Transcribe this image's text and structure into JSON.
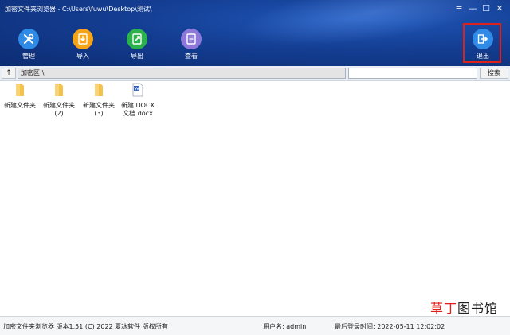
{
  "window": {
    "title": "加密文件夹浏览器 - C:\\Users\\fuwu\\Desktop\\测试\\",
    "controls": {
      "menu": "≡",
      "minimize": "—",
      "maximize": "☐",
      "close": "✕"
    }
  },
  "toolbar": {
    "manage": {
      "label": "管理",
      "icon": "tools-icon",
      "color": "#2f8be6"
    },
    "import": {
      "label": "导入",
      "icon": "import-icon",
      "color": "#f5a417"
    },
    "export": {
      "label": "导出",
      "icon": "export-icon",
      "color": "#2bb24c"
    },
    "view": {
      "label": "查看",
      "icon": "view-icon",
      "color": "#8d77d9"
    },
    "exit": {
      "label": "退出",
      "icon": "exit-icon",
      "color": "#2f8be6",
      "highlight": "#e0211b"
    }
  },
  "pathbar": {
    "up_label": "↑",
    "path": "加密区:\\",
    "search_value": "",
    "search_button": "搜索"
  },
  "files": [
    {
      "name": "新建文件夹",
      "type": "folder"
    },
    {
      "name": "新建文件夹 (2)",
      "type": "folder"
    },
    {
      "name": "新建文件夹 (3)",
      "type": "folder"
    },
    {
      "name": "新建 DOCX 文档.docx",
      "type": "docx"
    }
  ],
  "status": {
    "app_info": "加密文件夹浏览器 版本1.51 (C) 2022 夏冰软件 版权所有",
    "user": "用户名: admin",
    "last_login": "最后登录时间: 2022-05-11 12:02:02"
  },
  "watermark": {
    "accent": "草丁",
    "rest": "图书馆"
  }
}
